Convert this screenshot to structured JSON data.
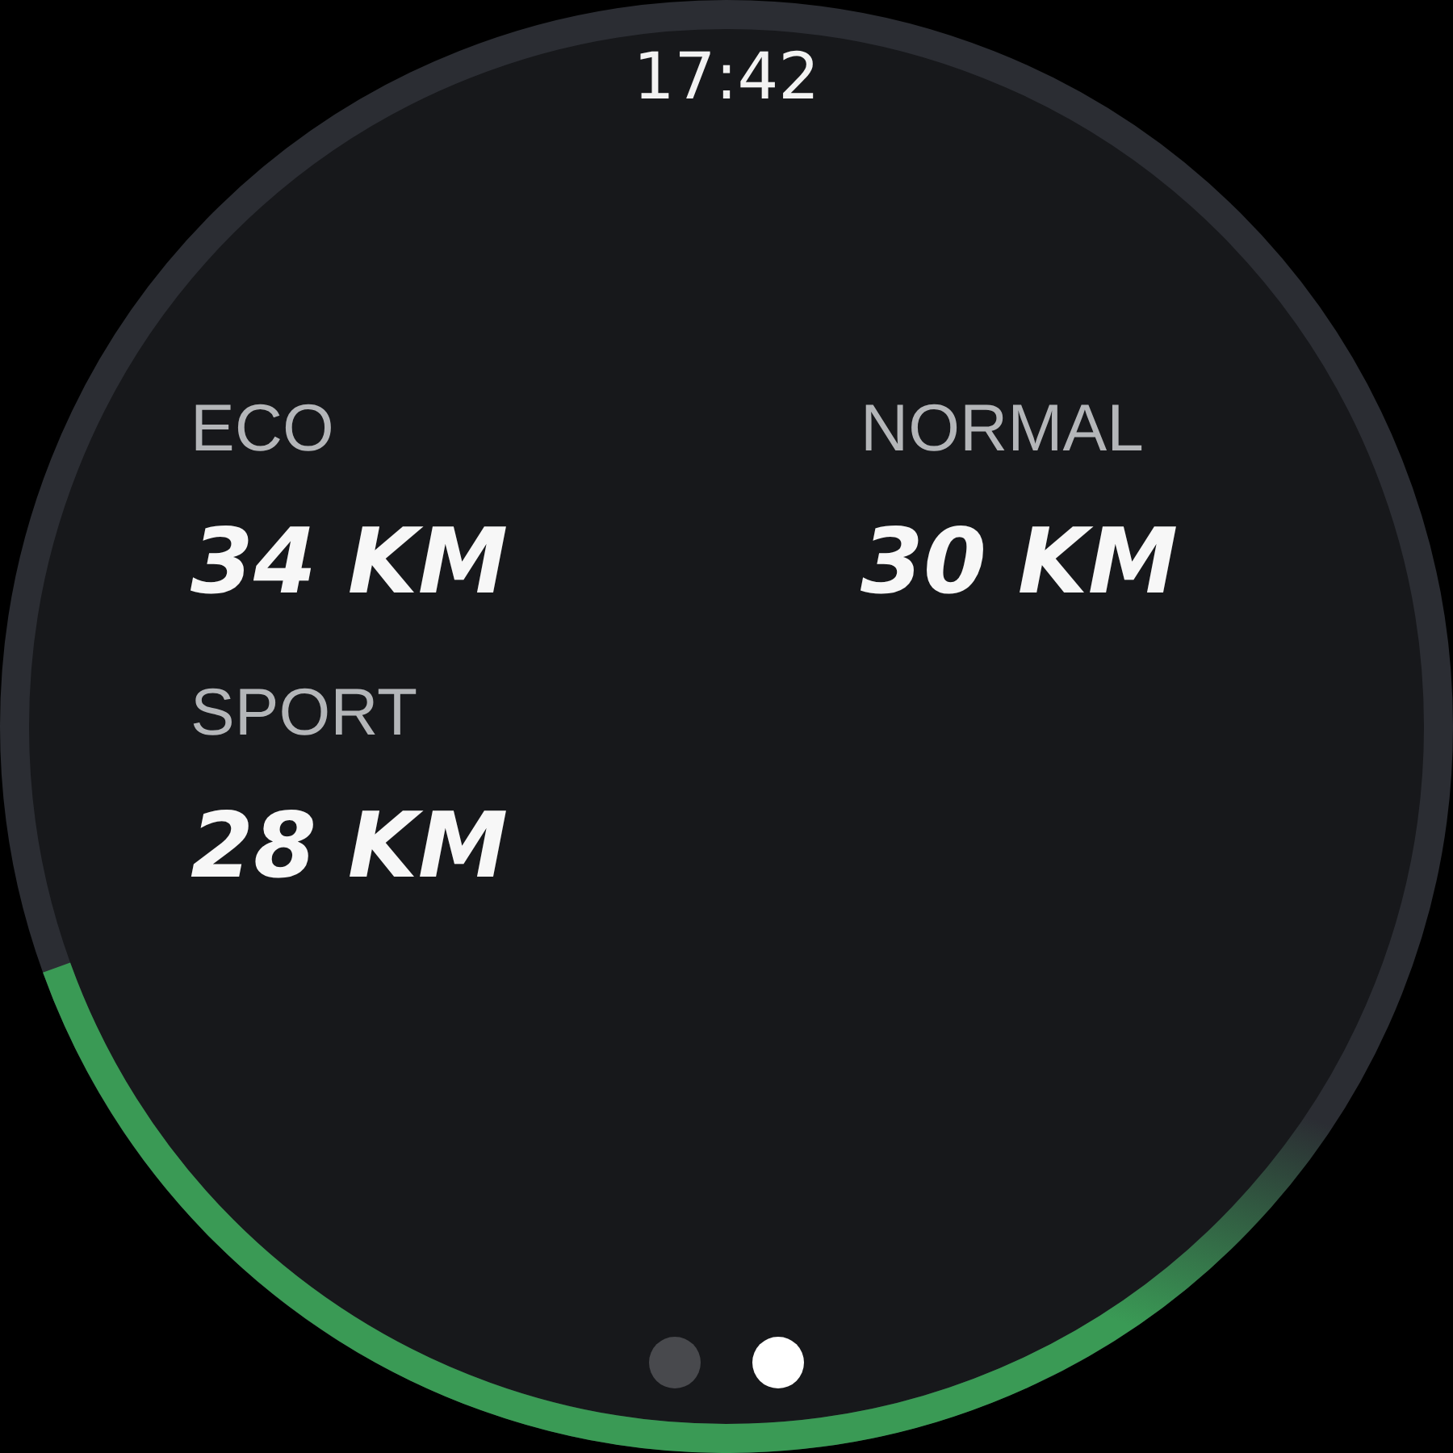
{
  "status_bar": {
    "time": "17:42"
  },
  "ring": {
    "level": 0.39
  },
  "modes": [
    {
      "label": "ECO",
      "range": "34 KM"
    },
    {
      "label": "NORMAL",
      "range": "30 KM"
    },
    {
      "label": "SPORT",
      "range": "28 KM"
    }
  ],
  "page_dots": [
    {
      "selected": false
    },
    {
      "selected": true
    }
  ]
}
